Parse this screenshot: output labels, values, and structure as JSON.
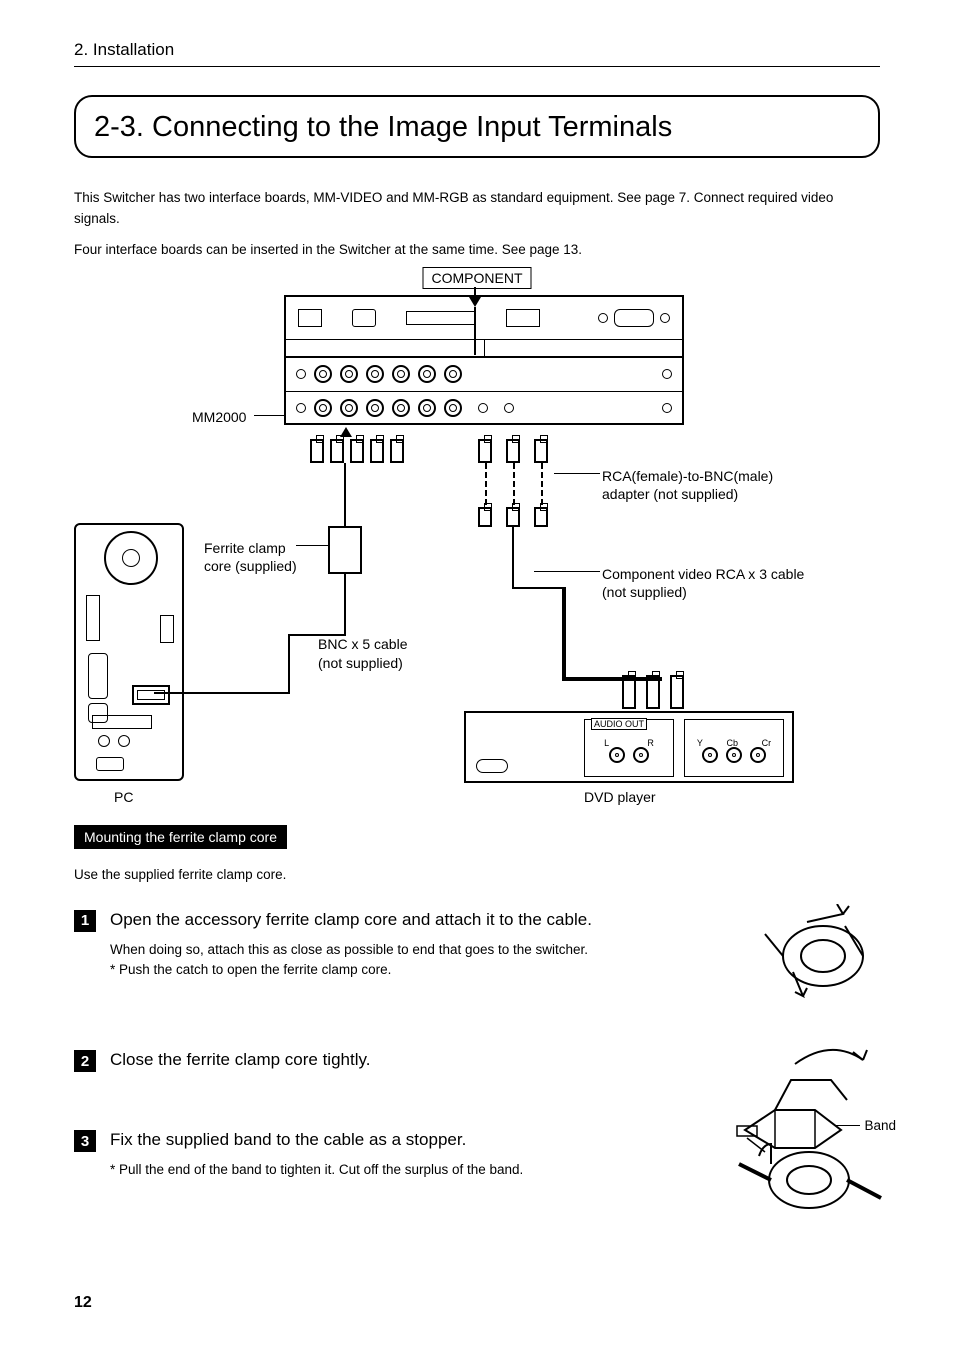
{
  "breadcrumb": "2. Installation",
  "section_title": "2-3. Connecting to the Image Input Terminals",
  "intro_line1": "This Switcher has two interface boards, MM-VIDEO and MM-RGB as standard equipment. See page 7. Connect required video signals.",
  "intro_line2": "Four interface boards can be inserted in the Switcher at the same time. See page 13.",
  "diagram": {
    "component_label": "COMPONENT",
    "mm2000_label": "MM2000",
    "ferrite_label_1": "Ferrite clamp",
    "ferrite_label_2": "core (supplied)",
    "bnc5_label_1": "BNC x 5 cable",
    "bnc5_label_2": "(not supplied)",
    "rca_label_1": "RCA(female)-to-BNC(male)",
    "rca_label_2": "adapter (not supplied)",
    "compcable_label_1": "Component video RCA x 3 cable",
    "compcable_label_2": "(not supplied)",
    "pc_label": "PC",
    "dvd_label": "DVD player",
    "audio_out": "AUDIO OUT",
    "L": "L",
    "R": "R",
    "Y": "Y",
    "Cb": "Cb",
    "Cr": "Cr",
    "componentword": "Component"
  },
  "sub_heading": "Mounting the ferrite clamp core",
  "use_text": "Use the supplied ferrite clamp core.",
  "steps": [
    {
      "num": "1",
      "title": "Open the accessory ferrite clamp core and attach it to the cable.",
      "detail1": "When doing so, attach this as close as possible to end that goes to the switcher.",
      "detail2": "* Push the catch to open the ferrite clamp core."
    },
    {
      "num": "2",
      "title": "Close the ferrite clamp core tightly.",
      "detail1": "",
      "detail2": ""
    },
    {
      "num": "3",
      "title": "Fix the supplied band to the cable as a stopper.",
      "detail1": "* Pull the end of the band to tighten it. Cut off the surplus of the band.",
      "detail2": ""
    }
  ],
  "band_label": "Band",
  "page_number": "12"
}
